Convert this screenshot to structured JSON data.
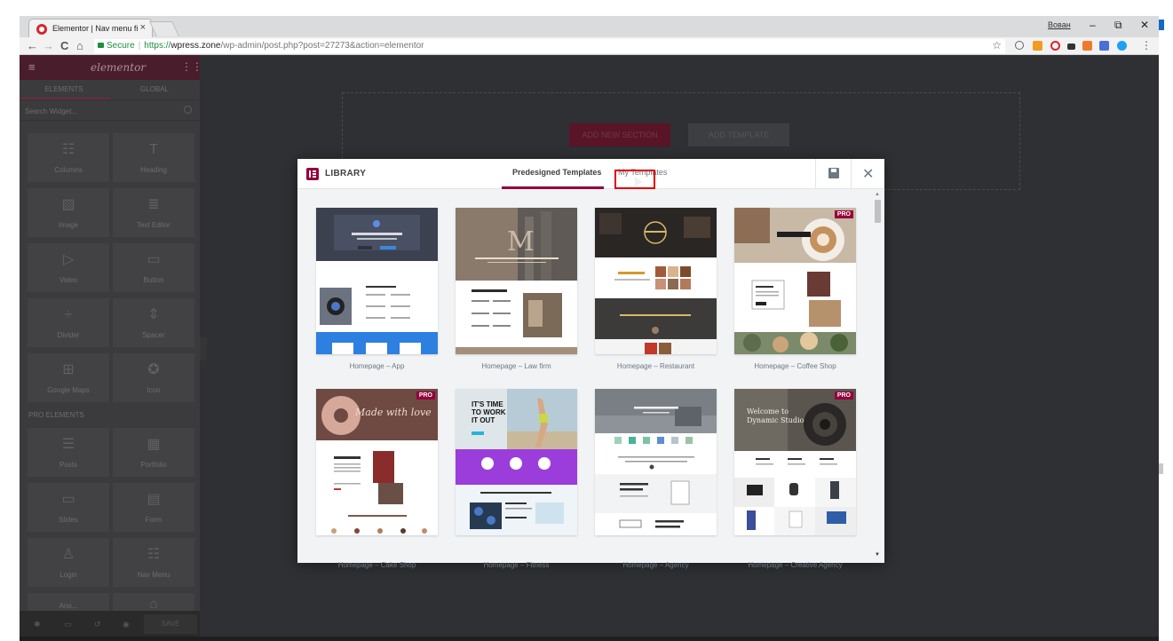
{
  "browser": {
    "tab_title": "Elementor | Nav menu fi",
    "tab_close": "×",
    "user": "Вован",
    "window_controls": {
      "minimize": "–",
      "restore": "⧉",
      "close": "✕"
    },
    "nav": {
      "back": "←",
      "forward": "→",
      "reload": "C",
      "home": "⌂"
    },
    "secure_label": "Secure",
    "url_scheme": "https://",
    "url_host": "wpress.zone",
    "url_path": "/wp-admin/post.php?post=27273&action=elementor",
    "extensions": [
      "recycle-icon",
      "rss-icon",
      "opera-icon",
      "ext-icon",
      "ext-icon",
      "translate-icon",
      "chat-icon"
    ],
    "menu_icon": "⋮"
  },
  "panel": {
    "logo": "elementor",
    "tabs": [
      "ELEMENTS",
      "GLOBAL"
    ],
    "search_placeholder": "Search Widget...",
    "pro_label": "PRO ELEMENTS",
    "widgets": [
      {
        "label": "Columns",
        "icon": "columns-icon"
      },
      {
        "label": "Heading",
        "icon": "heading-icon"
      },
      {
        "label": "Image",
        "icon": "image-icon"
      },
      {
        "label": "Text Editor",
        "icon": "text-editor-icon"
      },
      {
        "label": "Video",
        "icon": "video-icon"
      },
      {
        "label": "Button",
        "icon": "button-icon"
      },
      {
        "label": "Divider",
        "icon": "divider-icon"
      },
      {
        "label": "Spacer",
        "icon": "spacer-icon"
      },
      {
        "label": "Google Maps",
        "icon": "map-icon"
      },
      {
        "label": "Icon",
        "icon": "star-icon"
      }
    ],
    "pro_widgets": [
      {
        "label": "Posts",
        "icon": "posts-icon"
      },
      {
        "label": "Portfolio",
        "icon": "portfolio-icon"
      },
      {
        "label": "Slides",
        "icon": "slides-icon"
      },
      {
        "label": "Form",
        "icon": "form-icon"
      },
      {
        "label": "Login",
        "icon": "login-icon"
      },
      {
        "label": "Nav Menu",
        "icon": "nav-menu-icon"
      },
      {
        "label": "Ano...",
        "icon": "anchor-icon"
      }
    ],
    "footer_save": "SAVE"
  },
  "canvas": {
    "add_section": "ADD NEW SECTION",
    "add_template": "ADD TEMPLATE"
  },
  "library": {
    "title": "LIBRARY",
    "tabs": [
      "Predesigned Templates",
      "My Templates"
    ],
    "active_tab": "Predesigned Templates",
    "pro_badge": "PRO",
    "templates": [
      {
        "title": "Homepage – App",
        "pro": false
      },
      {
        "title": "Homepage – Law firm",
        "pro": false
      },
      {
        "title": "Homepage – Restaurant",
        "pro": false
      },
      {
        "title": "Homepage – Coffee Shop",
        "pro": true
      },
      {
        "title": "Homepage – Cake Shop",
        "pro": true
      },
      {
        "title": "Homepage – Fitness",
        "pro": false
      },
      {
        "title": "Homepage – Agency",
        "pro": false
      },
      {
        "title": "Homepage – Creative Agency",
        "pro": true
      }
    ]
  },
  "colors": {
    "brand": "#93003c",
    "panel_bg": "#3b3b3d",
    "canvas_bg": "#2f3033",
    "highlight": "#e00000"
  }
}
